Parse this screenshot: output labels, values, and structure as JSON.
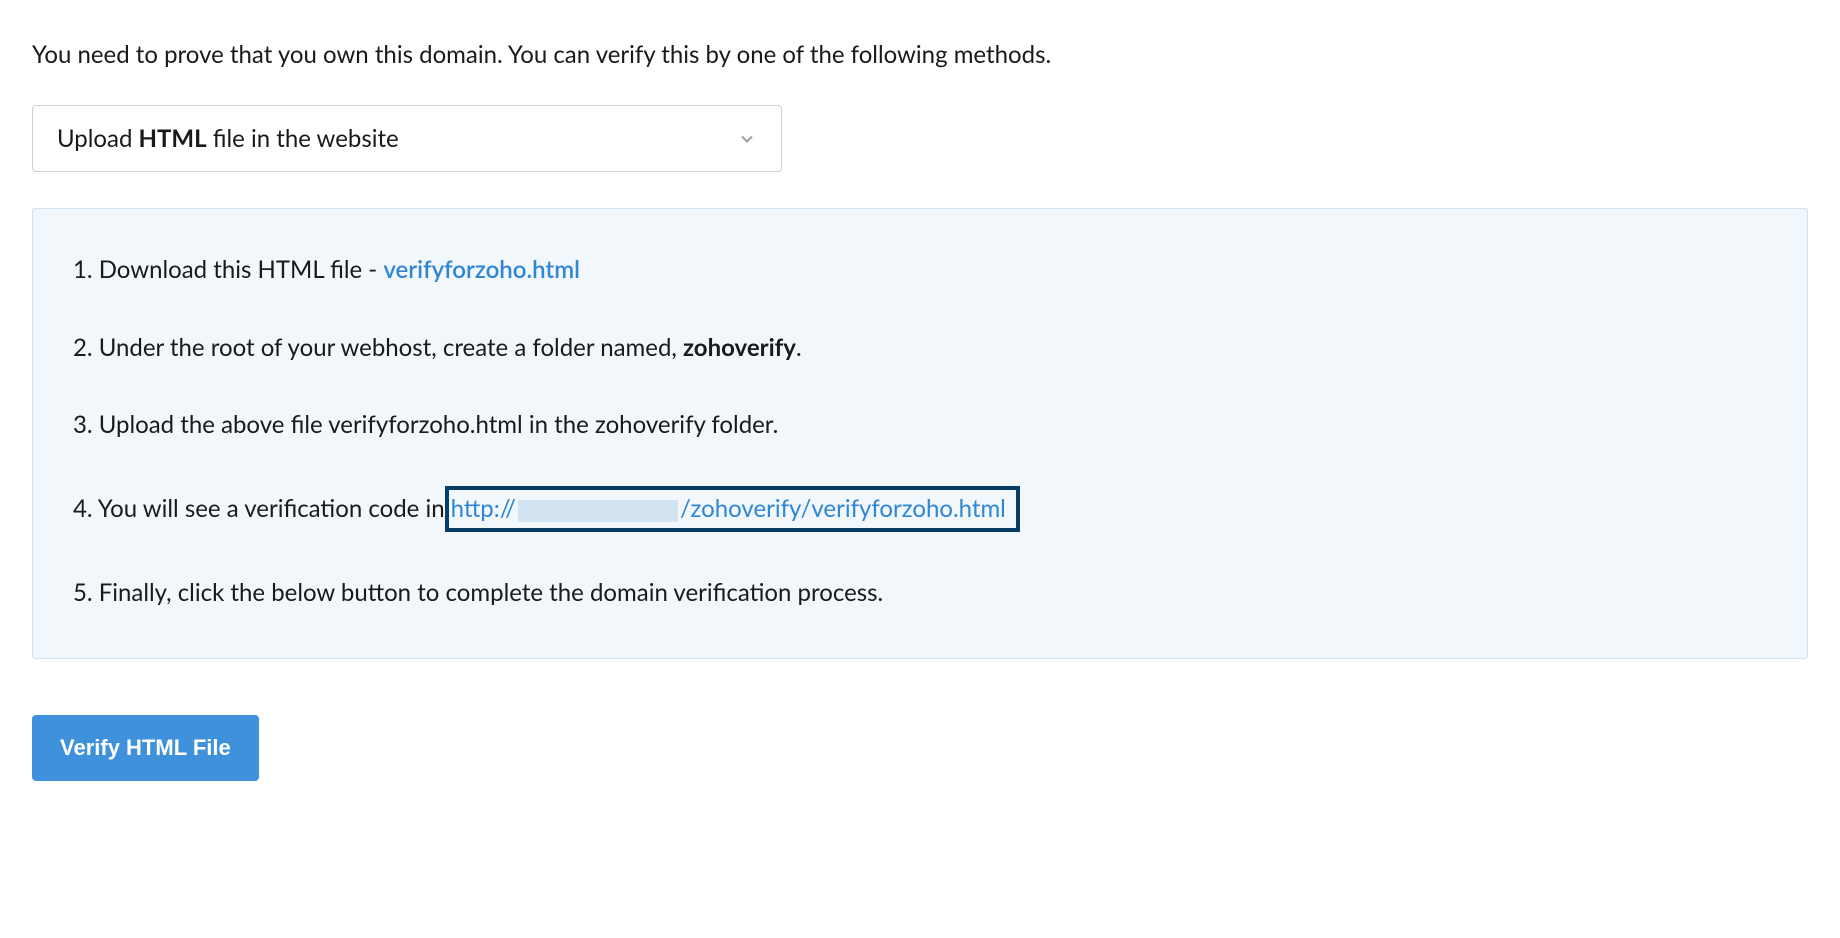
{
  "intro": "You need to prove that you own this domain. You can verify this by one of the following methods.",
  "dropdown": {
    "prefix": "Upload ",
    "bold": "HTML",
    "suffix": " file in the website"
  },
  "steps": {
    "step1_prefix": "1. Download this HTML file - ",
    "step1_link": "verifyforzoho.html",
    "step2_prefix": "2. Under the root of your webhost, create a folder named, ",
    "step2_bold": "zohoverify",
    "step2_suffix": ".",
    "step3": "3. Upload the above file verifyforzoho.html in the zohoverify folder.",
    "step4_prefix": "4. You will see a verification code in",
    "step4_url_prefix": " http://",
    "step4_url_suffix": "/zohoverify/verifyforzoho.html",
    "step5": "5. Finally, click the below button to complete the domain verification process."
  },
  "button": {
    "label": "Verify HTML File"
  }
}
